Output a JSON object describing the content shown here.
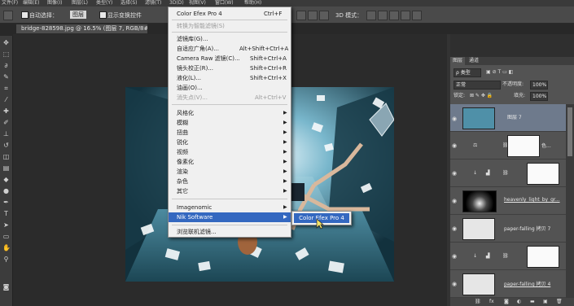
{
  "menubar": {
    "items": [
      "文件(F)",
      "编辑(E)",
      "图像(I)",
      "图层(L)",
      "类型(Y)",
      "选择(S)",
      "滤镜(T)",
      "3D(D)",
      "视图(V)",
      "窗口(W)",
      "帮助(H)"
    ]
  },
  "options": {
    "auto_select_label": "自动选择：",
    "auto_select_target": "图层",
    "show_transform_label": "显示变换控件",
    "mode_3d_label": "3D 模式："
  },
  "document_tab": {
    "title": "bridge-828598.jpg @ 16.5% (图层 7, RGB/8#) *"
  },
  "filter_menu": {
    "last_filter": {
      "label": "Color Efex Pro 4",
      "shortcut": "Ctrl+F"
    },
    "smart_filter": "转换为智能滤镜(S)",
    "group1": [
      {
        "label": "滤镜库(G)...",
        "shortcut": ""
      },
      {
        "label": "自适应广角(A)...",
        "shortcut": "Alt+Shift+Ctrl+A"
      },
      {
        "label": "Camera Raw 滤镜(C)...",
        "shortcut": "Shift+Ctrl+A"
      },
      {
        "label": "镜头校正(R)...",
        "shortcut": "Shift+Ctrl+R"
      },
      {
        "label": "液化(L)...",
        "shortcut": "Shift+Ctrl+X"
      },
      {
        "label": "油画(O)...",
        "shortcut": ""
      },
      {
        "label": "消失点(V)...",
        "shortcut": "Alt+Ctrl+V"
      }
    ],
    "group2": [
      "风格化",
      "模糊",
      "扭曲",
      "锐化",
      "视频",
      "像素化",
      "渲染",
      "杂色",
      "其它"
    ],
    "plugins": [
      "Imagenomic",
      "Nik Software"
    ],
    "browse_online": "浏览联机滤镜..."
  },
  "submenu": {
    "item": "Color Efex Pro 4"
  },
  "layers_panel": {
    "tabs": [
      "图层",
      "通道"
    ],
    "filter_kind": "ρ 类型",
    "blend_mode": "正常",
    "opacity_label": "不透明度:",
    "opacity_value": "100%",
    "lock_label": "锁定:",
    "fill_label": "填充:",
    "fill_value": "100%",
    "layers": [
      {
        "name": "图层 7",
        "selected": true
      },
      {
        "name": "色...",
        "selected": false
      },
      {
        "name": "",
        "selected": false
      },
      {
        "name": "heavenly_light_by_gr...",
        "selected": false
      },
      {
        "name": "paper-falling 拷贝 7",
        "selected": false
      },
      {
        "name": "",
        "selected": false
      },
      {
        "name": "paper-falling 拷贝 4",
        "selected": false
      }
    ]
  },
  "colors": {
    "highlight": "#3468c0",
    "selected_layer": "#6e7a8c"
  }
}
